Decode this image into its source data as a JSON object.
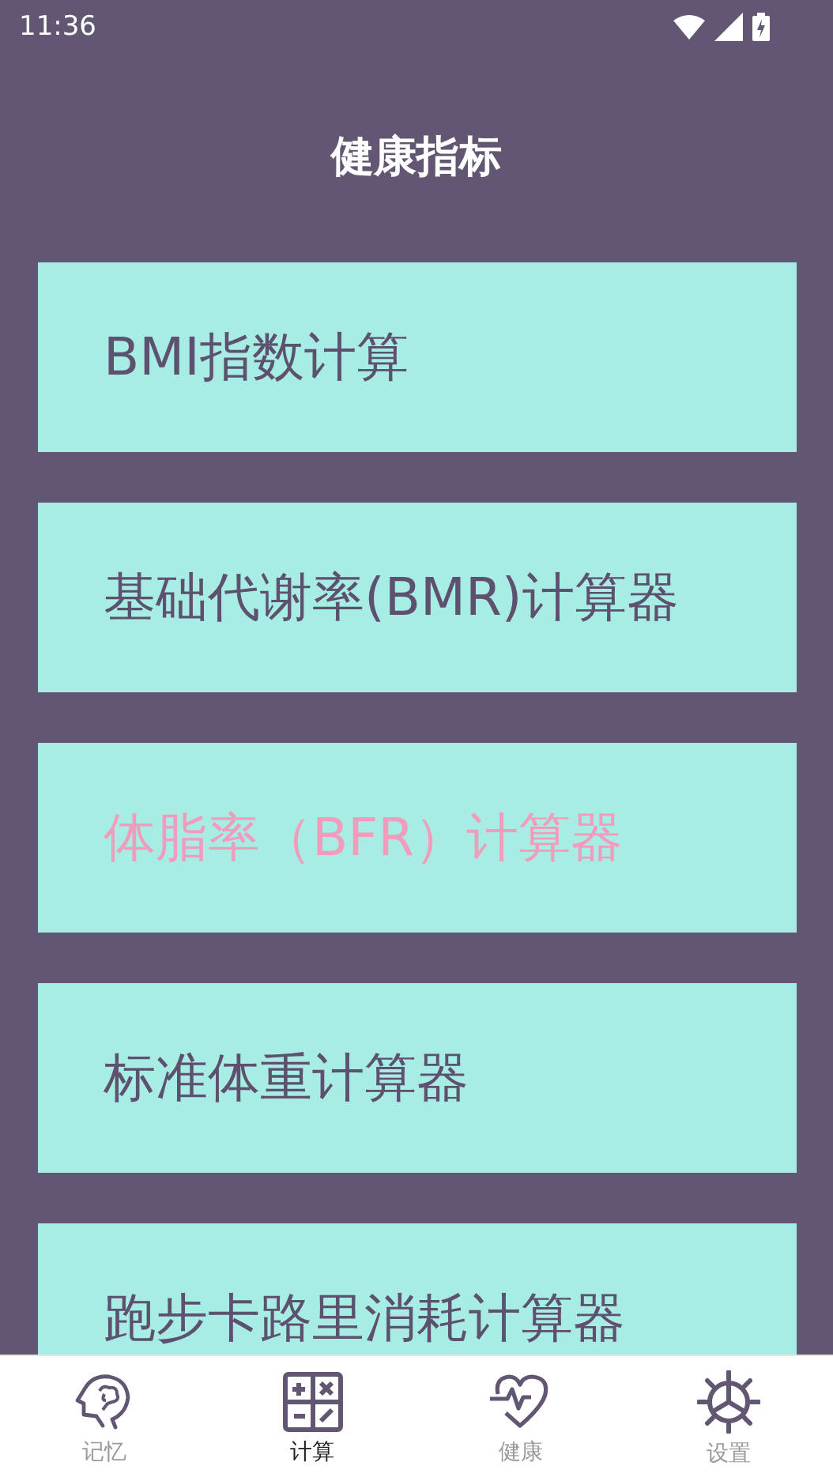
{
  "status_bar": {
    "time": "11:36"
  },
  "header": {
    "title": "健康指标"
  },
  "items": [
    {
      "label": "BMI指数计算",
      "highlighted": false
    },
    {
      "label": "基础代谢率(BMR)计算器",
      "highlighted": false
    },
    {
      "label": "体脂率（BFR）计算器",
      "highlighted": true
    },
    {
      "label": "标准体重计算器",
      "highlighted": false
    },
    {
      "label": "跑步卡路里消耗计算器",
      "highlighted": false
    }
  ],
  "bottom_nav": [
    {
      "label": "记忆",
      "kind": "head",
      "selected": false
    },
    {
      "label": "计算",
      "kind": "calculator",
      "selected": true
    },
    {
      "label": "健康",
      "kind": "heart",
      "selected": false
    },
    {
      "label": "设置",
      "kind": "gear",
      "selected": false
    }
  ]
}
